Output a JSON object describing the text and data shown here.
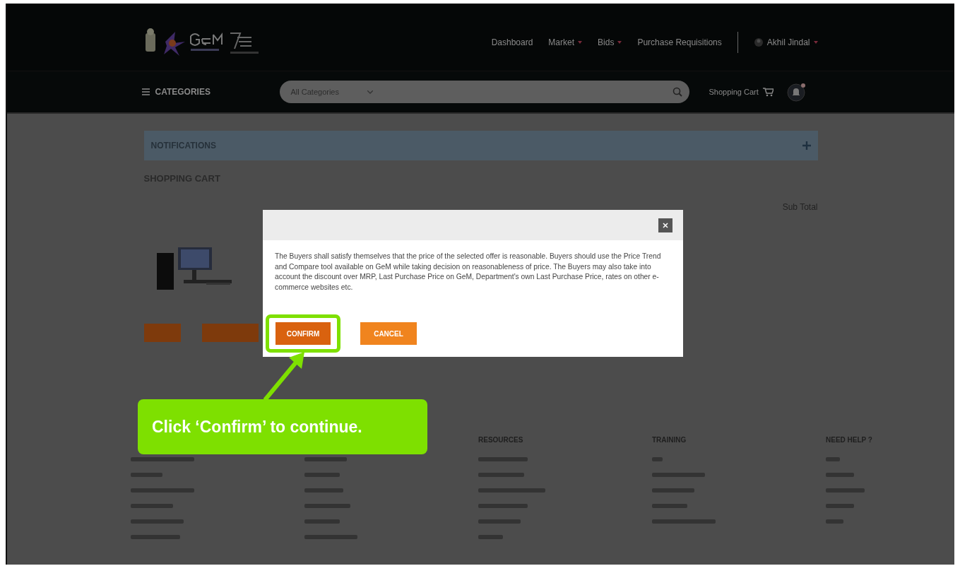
{
  "header": {
    "nav": [
      {
        "label": "Dashboard",
        "dropdown": false
      },
      {
        "label": "Market",
        "dropdown": true
      },
      {
        "label": "Bids",
        "dropdown": true
      },
      {
        "label": "Purchase Requisitions",
        "dropdown": false
      }
    ],
    "user": "Akhil Jindal",
    "categories_label": "CATEGORIES",
    "search": {
      "value": "All Categories"
    },
    "cart_label": "Shopping Cart"
  },
  "notifications": {
    "title": "NOTIFICATIONS"
  },
  "cart": {
    "title": "SHOPPING CART",
    "columns": [
      "Sub Total"
    ]
  },
  "modal": {
    "message": "The Buyers shall satisfy themselves that the price of the selected offer is reasonable. Buyers should use the Price Trend and Compare tool available on GeM while taking decision on reasonableness of price. The Buyers may also take into account the discount over MRP, Last Purchase Price on GeM, Department's own Last Purchase Price, rates on other e-commerce websites etc.",
    "buttons": [
      {
        "label": "CONFIRM",
        "highlighted": true
      },
      {
        "label": "CANCEL",
        "highlighted": false
      }
    ]
  },
  "footer": {
    "columns": [
      {
        "heading": "RESOURCES"
      },
      {
        "heading": "TRAINING"
      },
      {
        "heading": "NEED HELP ?"
      }
    ]
  },
  "callout": {
    "text": "Click ‘Confirm’ to continue."
  }
}
